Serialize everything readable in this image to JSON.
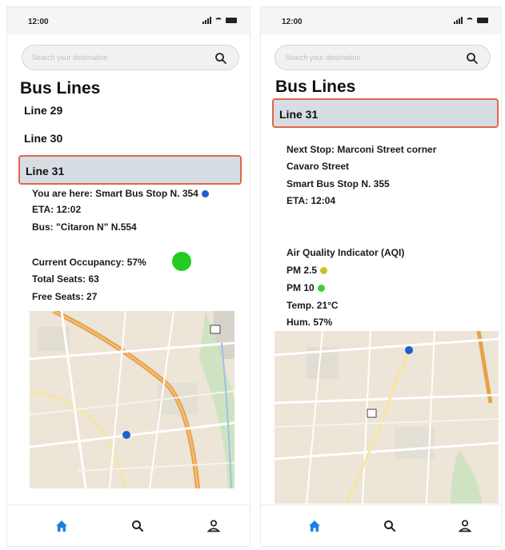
{
  "status": {
    "time": "12:00"
  },
  "search": {
    "placeholder": "Search your destination"
  },
  "title": "Bus Lines",
  "left": {
    "lines": [
      "Line 29",
      "Line 30"
    ],
    "selected_line": "Line 31",
    "location": "You are here: Smart Bus Stop N. 354",
    "eta": "ETA: 12:02",
    "bus": "Bus: \"Citaron N\" N.554",
    "occupancy": "Current Occupancy: 57%",
    "total_seats": "Total Seats: 63",
    "free_seats": "Free Seats: 27"
  },
  "right": {
    "selected_line": "Line 31",
    "next_stop_1": "Next Stop: Marconi Street corner",
    "next_stop_2": "Cavaro Street",
    "next_stop_3": "Smart Bus Stop N. 355",
    "eta": "ETA: 12:04",
    "aqi_title": "Air Quality Indicator (AQI)",
    "pm25": "PM 2.5",
    "pm10": "PM 10",
    "temp": "Temp. 21°C",
    "hum": "Hum. 57%"
  },
  "tabs": {
    "home_icon": "home-icon",
    "search_icon": "search-icon",
    "profile_icon": "profile-icon"
  },
  "colors": {
    "accent_blue": "#1f7fe0",
    "selected_bg": "#d6dde3",
    "selected_border": "#e0664a",
    "dot_blue": "#1f5fcc",
    "pm25_color": "#c9c22f",
    "pm10_color": "#3cce3c",
    "occupancy_color": "#22cc22"
  }
}
